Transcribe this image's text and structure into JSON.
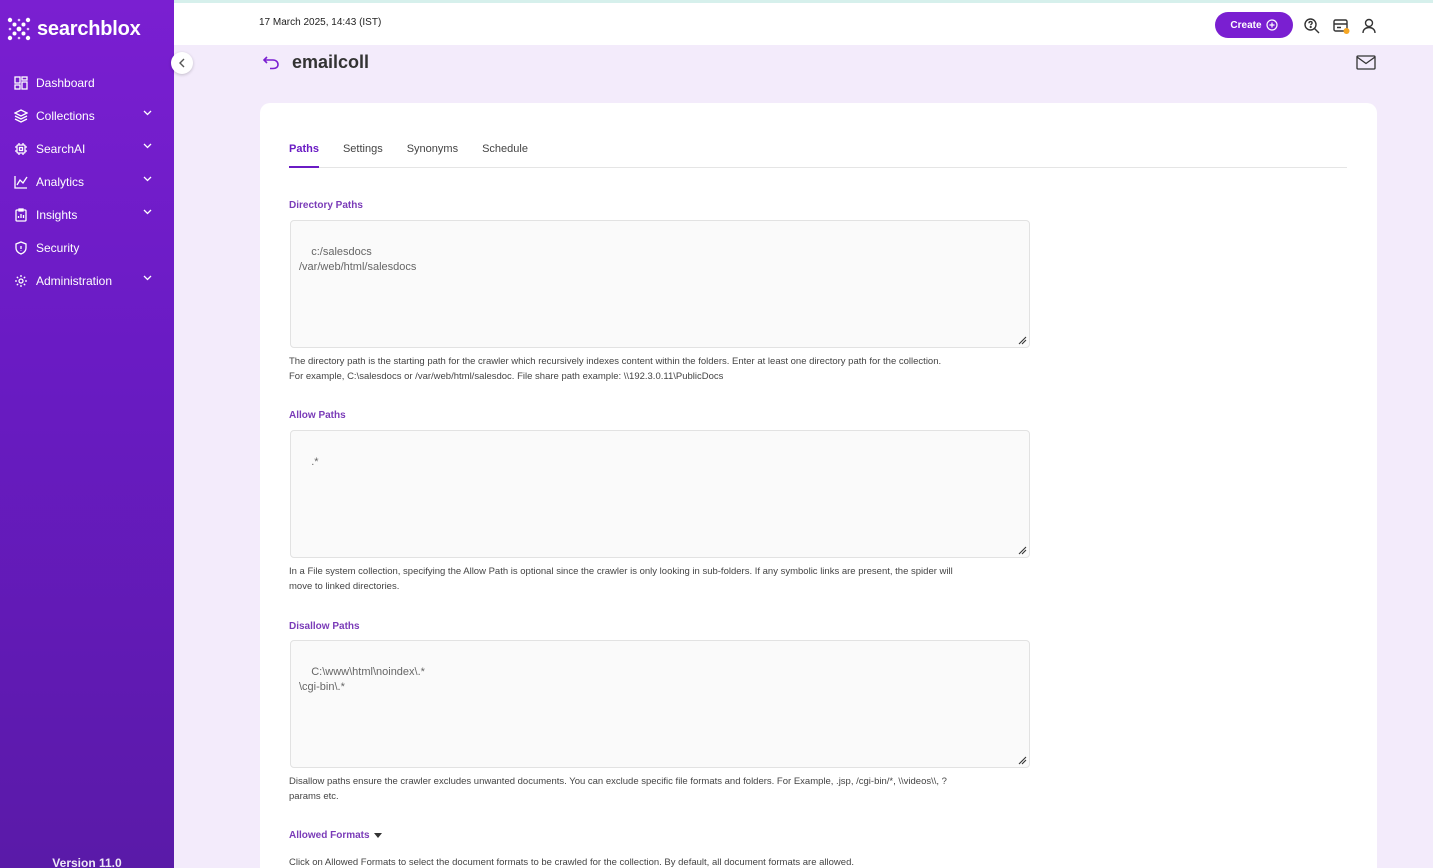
{
  "brand": {
    "name": "searchblox",
    "accent": "#7a1fd1"
  },
  "sidebar": {
    "items": [
      {
        "label": "Dashboard",
        "icon": "dashboard-icon",
        "expandable": false
      },
      {
        "label": "Collections",
        "icon": "layers-icon",
        "expandable": true
      },
      {
        "label": "SearchAI",
        "icon": "chip-icon",
        "expandable": true
      },
      {
        "label": "Analytics",
        "icon": "chart-icon",
        "expandable": true
      },
      {
        "label": "Insights",
        "icon": "clipboard-icon",
        "expandable": true
      },
      {
        "label": "Security",
        "icon": "shield-icon",
        "expandable": false
      },
      {
        "label": "Administration",
        "icon": "gear-icon",
        "expandable": true
      }
    ],
    "version": "Version 11.0"
  },
  "topbar": {
    "datetime": "17 March 2025, 14:43 (IST)",
    "create_label": "Create"
  },
  "page": {
    "title": "emailcoll"
  },
  "tabs": [
    {
      "label": "Paths",
      "active": true
    },
    {
      "label": "Settings",
      "active": false
    },
    {
      "label": "Synonyms",
      "active": false
    },
    {
      "label": "Schedule",
      "active": false
    }
  ],
  "fields": {
    "directory": {
      "label": "Directory Paths",
      "value": "c:/salesdocs\n/var/web/html/salesdocs",
      "help1": "The directory path is the starting path for the crawler which recursively indexes content within the folders. Enter at least one directory path for the collection.",
      "help2": "For example, C:\\salesdocs or /var/web/html/salesdoc. File share path example: \\\\192.3.0.11\\PublicDocs"
    },
    "allow": {
      "label": "Allow Paths",
      "value": ".*",
      "help1": "In a File system collection, specifying the Allow Path is optional since the crawler is only looking in sub-folders. If any symbolic links are present, the spider will",
      "help2": "move to linked directories."
    },
    "disallow": {
      "label": "Disallow Paths",
      "value": "C:\\www\\html\\noindex\\.*\n\\cgi-bin\\.*",
      "help1": "Disallow paths ensure the crawler excludes unwanted documents. You can exclude specific file formats and folders. For Example, .jsp, /cgi-bin/*, \\\\videos\\\\, ?",
      "help2": "params etc."
    },
    "formats": {
      "label": "Allowed Formats",
      "help": "Click on Allowed Formats to select the document formats to be crawled for the collection. By default, all document formats are allowed."
    }
  }
}
